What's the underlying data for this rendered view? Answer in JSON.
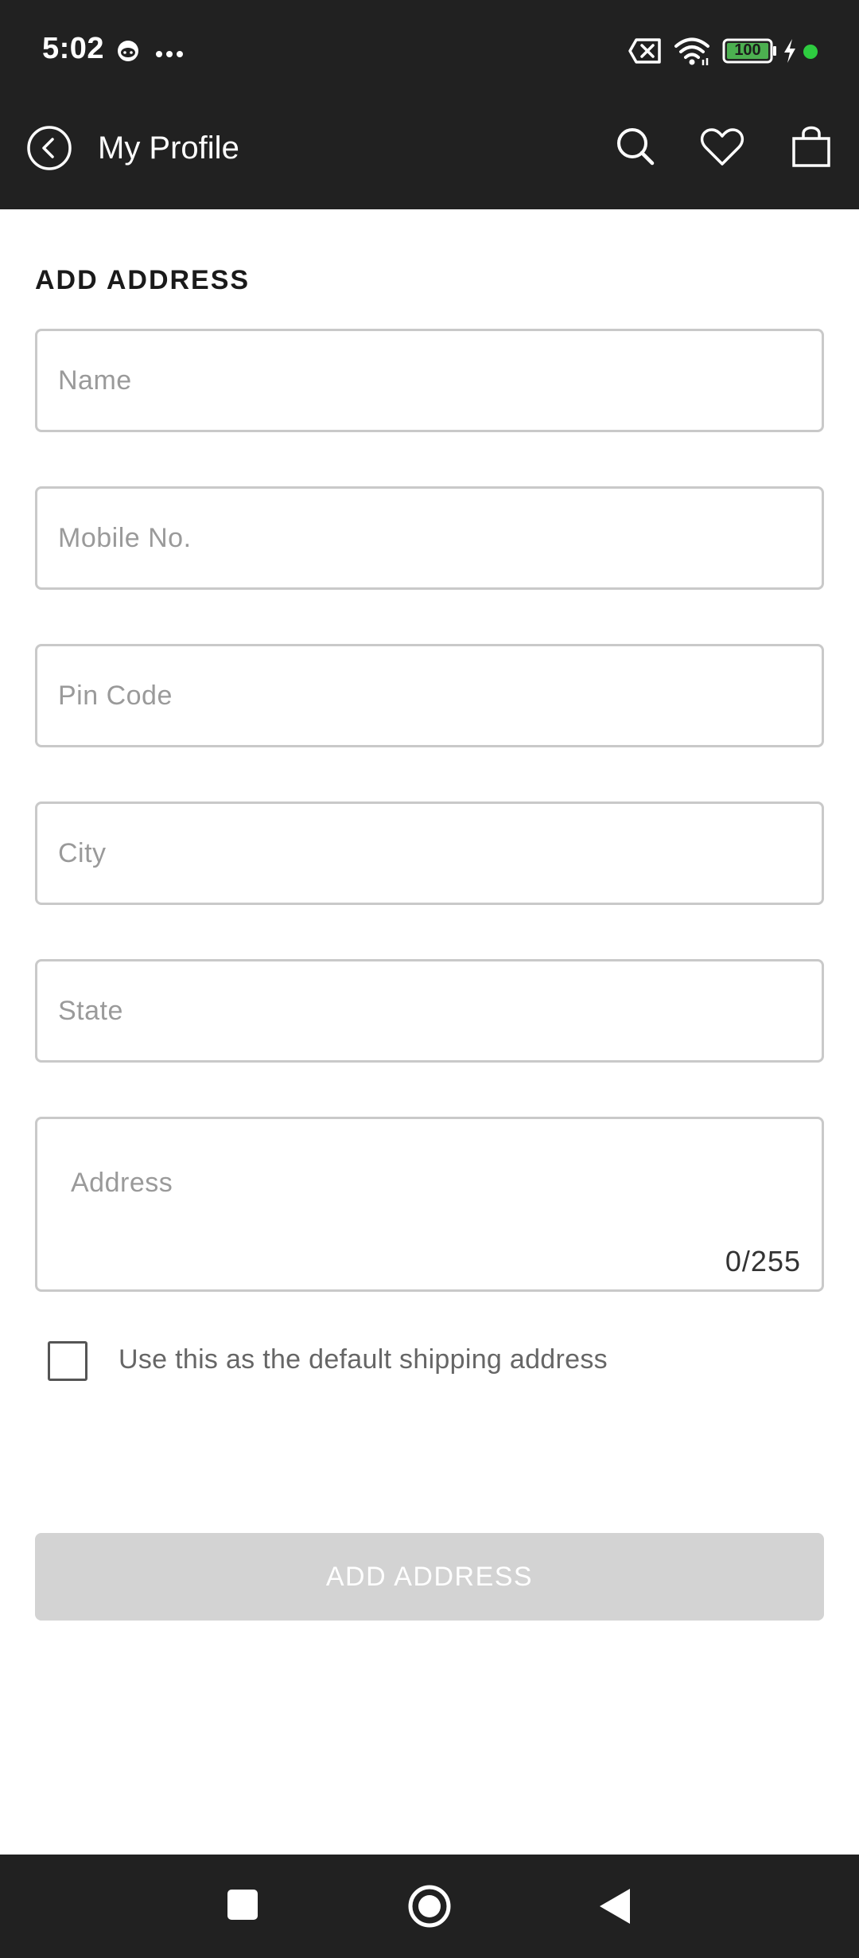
{
  "status_bar": {
    "time": "5:02",
    "battery_level": "100",
    "icons": [
      "cat-notification-icon",
      "more-dots-icon",
      "sim-off-icon",
      "wifi-icon",
      "battery-icon",
      "charging-icon",
      "active-dot-icon"
    ],
    "battery_color": "#4caf50",
    "dot_color": "#2ecc40"
  },
  "app_bar": {
    "title": "My Profile",
    "icons": [
      "back-icon",
      "search-icon",
      "heart-icon",
      "shopping-bag-icon"
    ],
    "background": "#212121"
  },
  "form": {
    "title": "ADD ADDRESS",
    "fields": {
      "name": {
        "placeholder": "Name",
        "value": ""
      },
      "mobile": {
        "placeholder": "Mobile No.",
        "value": ""
      },
      "pincode": {
        "placeholder": "Pin Code",
        "value": ""
      },
      "city": {
        "placeholder": "City",
        "value": ""
      },
      "state": {
        "placeholder": "State",
        "value": ""
      },
      "address": {
        "placeholder": "Address",
        "value": "",
        "counter": "0/255"
      }
    },
    "default_checkbox": {
      "label": "Use this as the default shipping address",
      "checked": false
    },
    "submit_label": "ADD ADDRESS",
    "submit_color": "#d3d3d3"
  },
  "nav_bar": {
    "icons": [
      "recents-square-icon",
      "home-circle-icon",
      "back-triangle-icon"
    ]
  }
}
